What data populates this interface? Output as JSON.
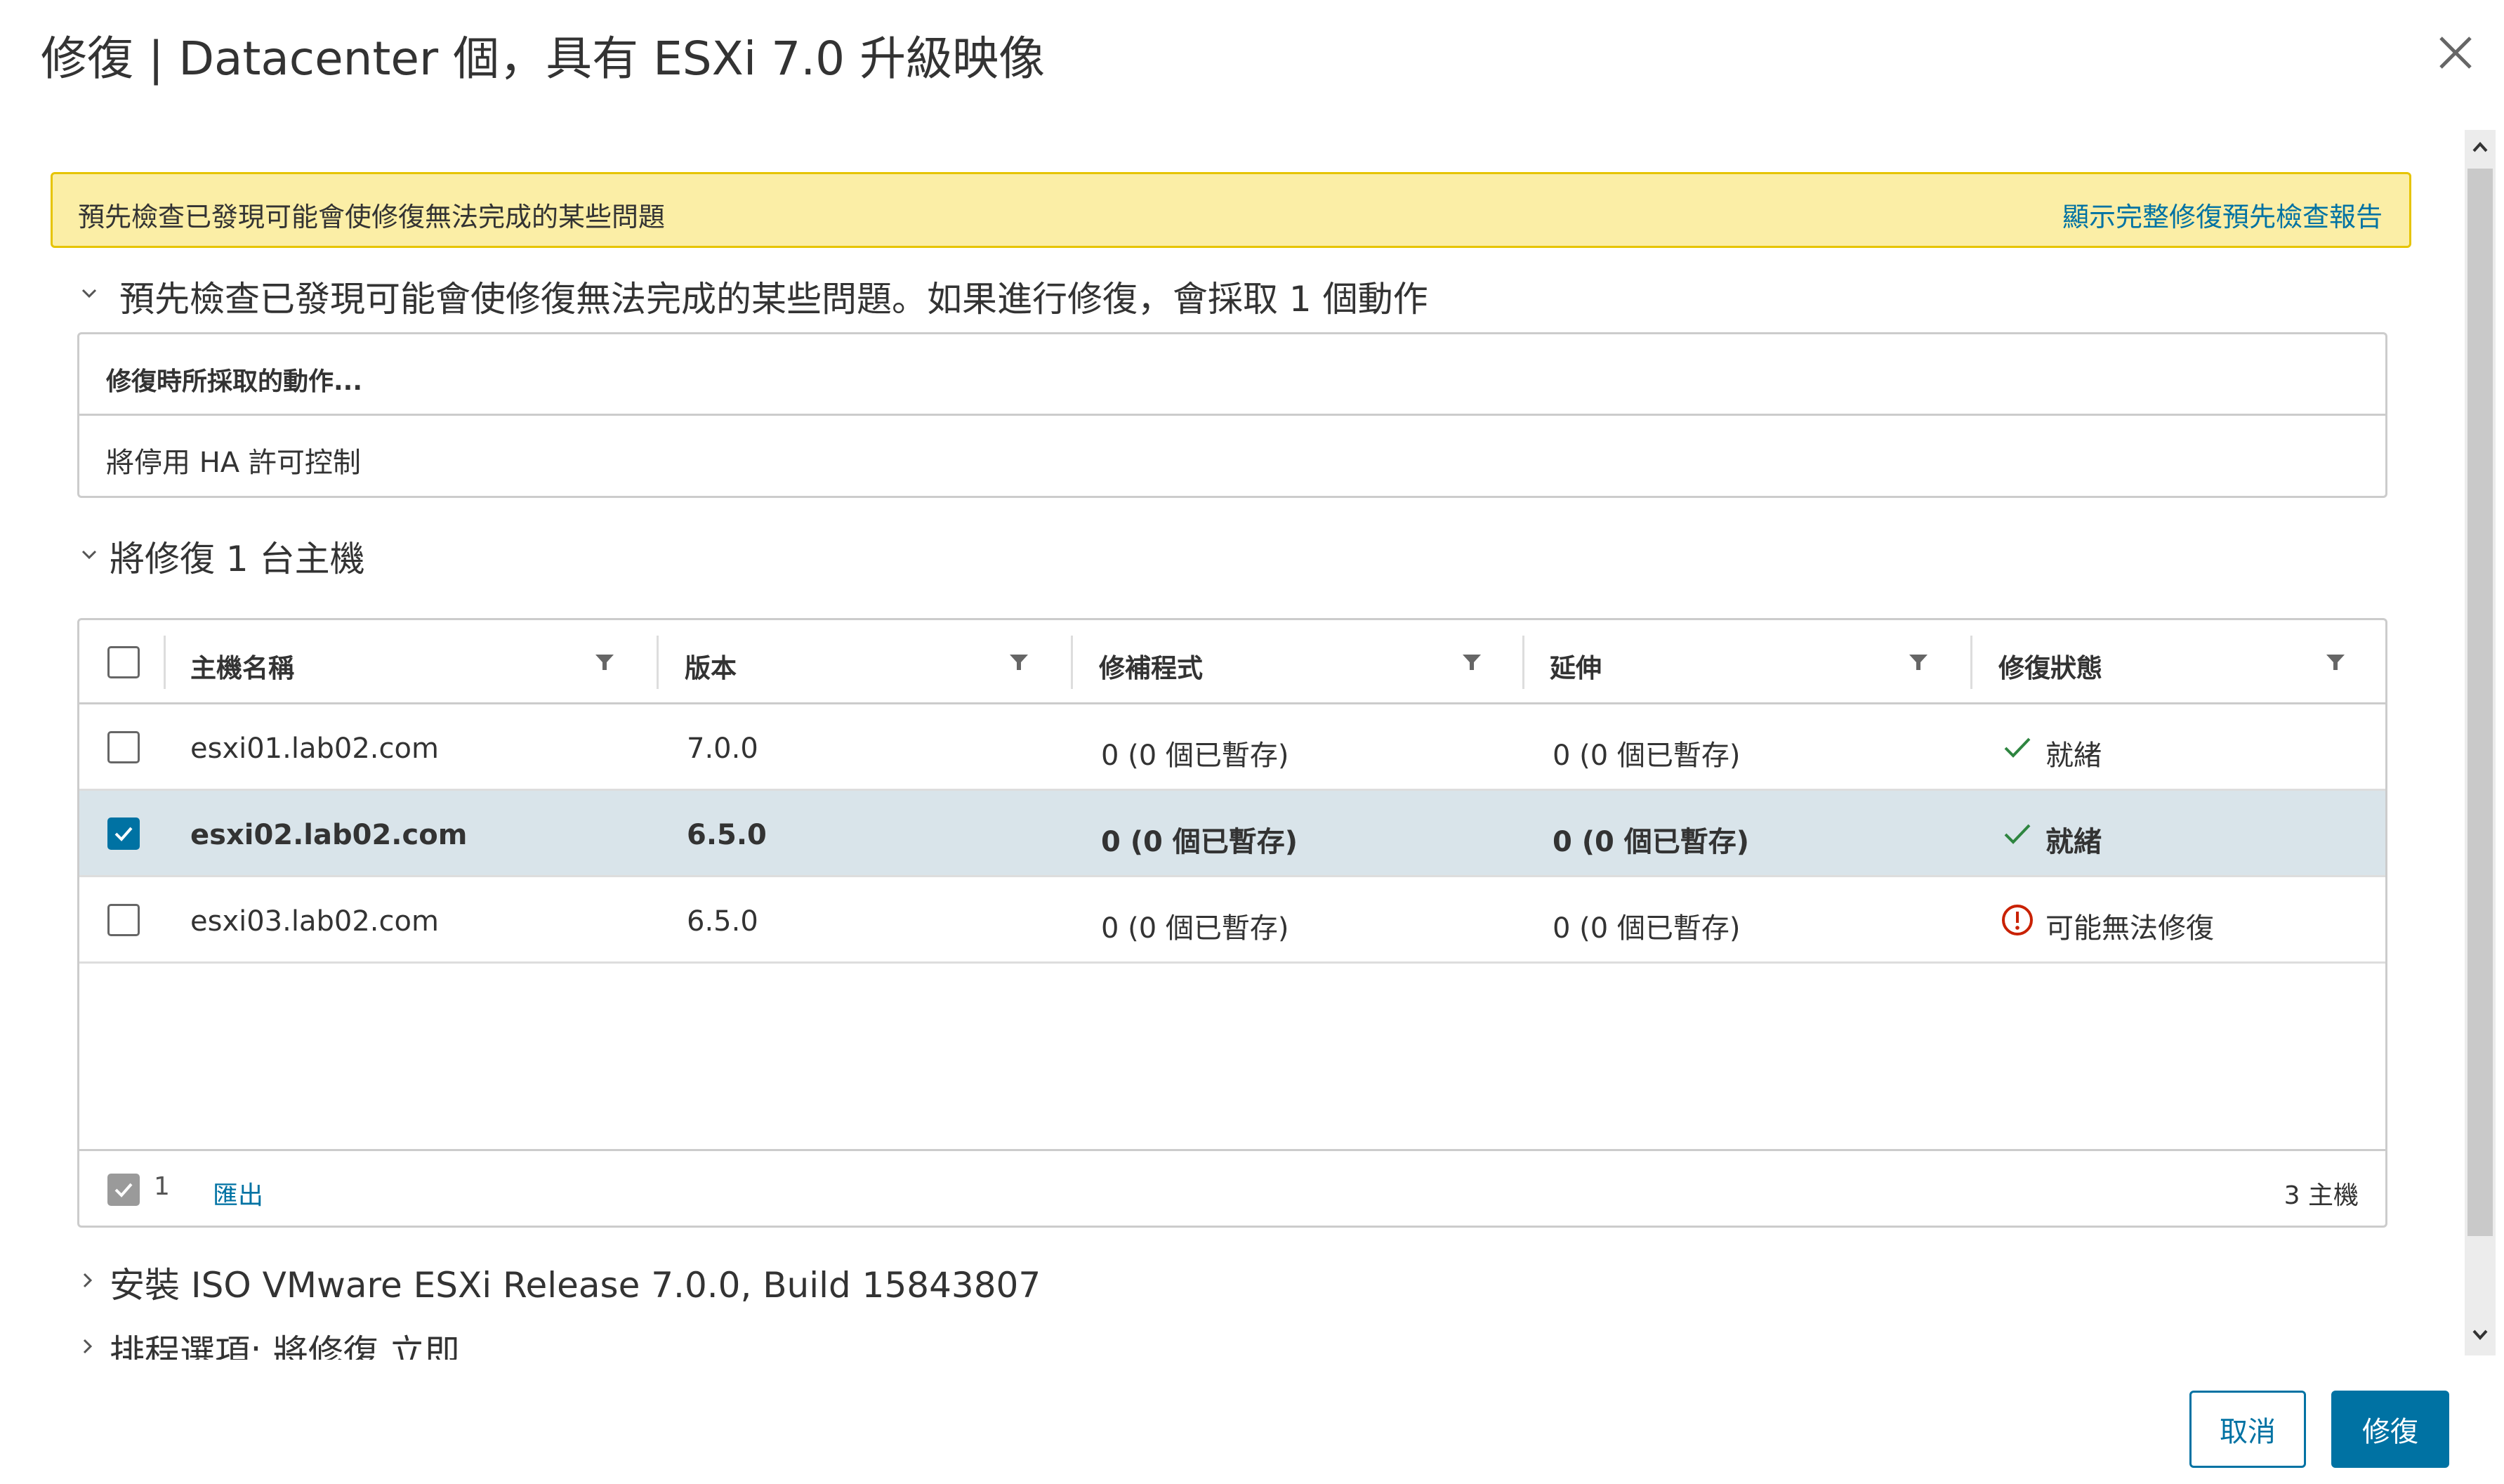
{
  "dialog": {
    "title": "修復 | Datacenter 個，具有 ESXi 7.0 升級映像",
    "close_icon": "close-icon"
  },
  "alert": {
    "message": "預先檢查已發現可能會使修復無法完成的某些問題",
    "link": "顯示完整修復預先檢查報告"
  },
  "sections": {
    "precheck": {
      "title": "預先檢查已發現可能會使修復無法完成的某些問題。如果進行修復，會採取 1 個動作",
      "table_header": "修復時所採取的動作...",
      "table_row": "將停用 HA 許可控制"
    },
    "hosts": {
      "title": "將修復 1 台主機"
    },
    "install": {
      "title": "安裝 ISO VMware ESXi Release 7.0.0, Build 15843807"
    },
    "schedule": {
      "title": "排程選項: 將修復 立即"
    }
  },
  "grid": {
    "columns": [
      "主機名稱",
      "版本",
      "修補程式",
      "延伸",
      "修復狀態"
    ],
    "rows": [
      {
        "host": "esxi01.lab02.com",
        "version": "7.0.0",
        "patches": "0 (0 個已暫存)",
        "extensions": "0 (0 個已暫存)",
        "status": "就緒",
        "status_icon": "check-icon",
        "checked": false
      },
      {
        "host": "esxi02.lab02.com",
        "version": "6.5.0",
        "patches": "0 (0 個已暫存)",
        "extensions": "0 (0 個已暫存)",
        "status": "就緒",
        "status_icon": "check-icon",
        "checked": true
      },
      {
        "host": "esxi03.lab02.com",
        "version": "6.5.0",
        "patches": "0 (0 個已暫存)",
        "extensions": "0 (0 個已暫存)",
        "status": "可能無法修復",
        "status_icon": "warning-circle-icon",
        "checked": false
      }
    ],
    "footer": {
      "selected_count": "1",
      "export": "匯出",
      "total": "3 主機"
    }
  },
  "buttons": {
    "cancel": "取消",
    "remediate": "修復"
  },
  "colors": {
    "accent": "#0072a3",
    "alert_bg": "#fbeea6",
    "alert_border": "#e6c400",
    "success": "#2e8540",
    "danger": "#c92100",
    "selected_row": "#d9e4ea"
  }
}
